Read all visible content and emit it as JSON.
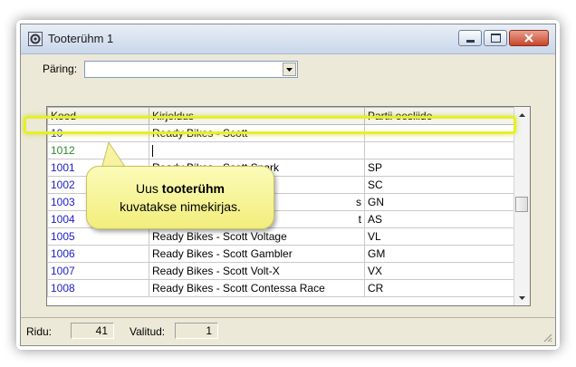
{
  "window": {
    "title": "Tooterühm 1"
  },
  "query": {
    "label": "Päring:",
    "value": ""
  },
  "grid": {
    "headers": [
      "Kood",
      "Kirjeldus",
      "Partii eesliide"
    ],
    "rows": [
      {
        "code": "10",
        "desc": "Ready Bikes - Scott",
        "prefix": ""
      },
      {
        "code": "1012",
        "desc": "",
        "prefix": ""
      },
      {
        "code": "1001",
        "desc": "Ready Bikes - Scott Spark",
        "prefix": "SP"
      },
      {
        "code": "1002",
        "desc": "",
        "prefix": "SC"
      },
      {
        "code": "1003",
        "desc": "s",
        "prefix": "GN"
      },
      {
        "code": "1004",
        "desc": "t",
        "prefix": "AS"
      },
      {
        "code": "1005",
        "desc": "Ready Bikes - Scott Voltage",
        "prefix": "VL"
      },
      {
        "code": "1006",
        "desc": "Ready Bikes - Scott Gambler",
        "prefix": "GM"
      },
      {
        "code": "1007",
        "desc": "Ready Bikes - Scott Volt-X",
        "prefix": "VX"
      },
      {
        "code": "1008",
        "desc": "Ready Bikes - Scott Contessa Race",
        "prefix": "CR"
      }
    ]
  },
  "callout": {
    "text_before": "Uus ",
    "text_bold": "tooterühm",
    "text_after": "kuvatakse nimekirjas."
  },
  "status": {
    "rows_label": "Ridu:",
    "rows_value": "41",
    "selected_label": "Valitud:",
    "selected_value": "1"
  },
  "colors": {
    "code_link": "#1c1cc8",
    "new_code": "#2a8a2a",
    "highlight": "#e6ef2a",
    "callout_bg": "#f8f59e"
  }
}
